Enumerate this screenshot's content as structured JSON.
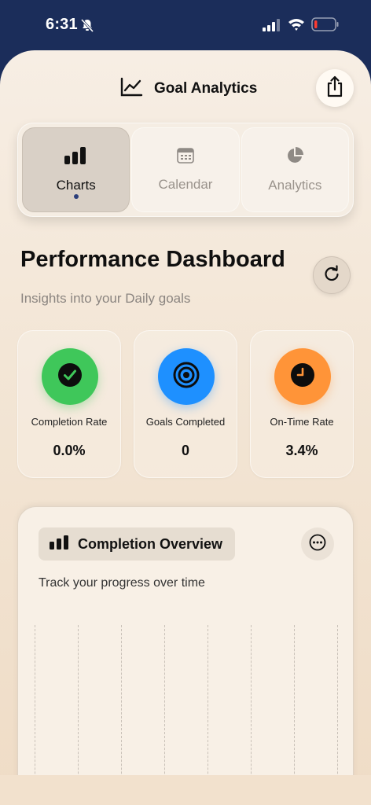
{
  "status_bar": {
    "time": "6:31"
  },
  "header": {
    "title": "Goal Analytics"
  },
  "tabs": [
    {
      "label": "Charts",
      "active": true,
      "icon": "bar-chart-icon"
    },
    {
      "label": "Calendar",
      "active": false,
      "icon": "calendar-icon"
    },
    {
      "label": "Analytics",
      "active": false,
      "icon": "pie-chart-icon"
    }
  ],
  "dashboard": {
    "title": "Performance Dashboard",
    "subtitle": "Insights into your Daily goals"
  },
  "stats": [
    {
      "label": "Completion Rate",
      "value": "0.0%",
      "color": "#3fc75a",
      "icon": "checkmark-icon"
    },
    {
      "label": "Goals Completed",
      "value": "0",
      "color": "#1e90ff",
      "icon": "target-icon"
    },
    {
      "label": "On-Time Rate",
      "value": "3.4%",
      "color": "#ff9438",
      "icon": "clock-icon"
    }
  ],
  "chart_card": {
    "title": "Completion Overview",
    "subtitle": "Track your progress over time"
  },
  "colors": {
    "accent_dot": "#2b3e7a",
    "status_bar_bg": "#1b2d5a"
  }
}
